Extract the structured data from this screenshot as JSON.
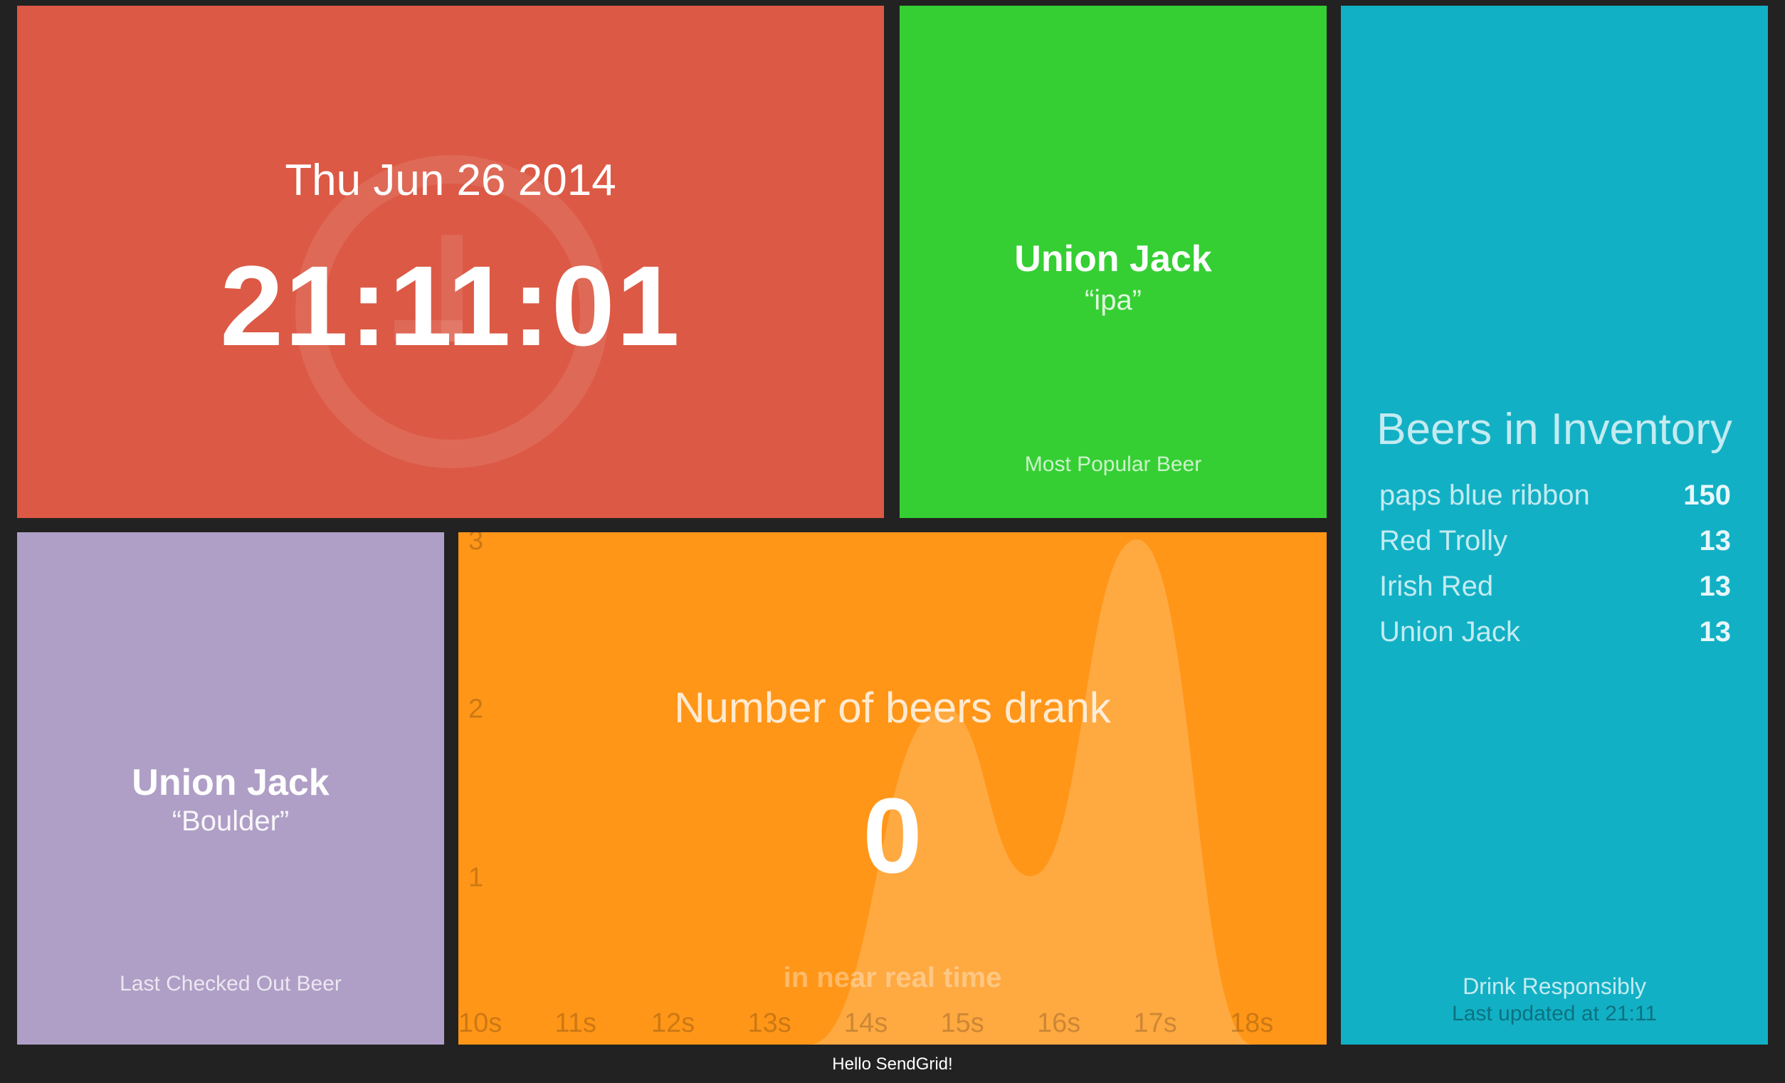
{
  "clock": {
    "date": "Thu Jun 26 2014",
    "time": "21:11:01",
    "color": "#dc5945"
  },
  "popular": {
    "name": "Union Jack",
    "style": "“ipa”",
    "caption": "Most Popular Beer",
    "color": "#35cf33"
  },
  "inventory": {
    "title": "Beers in Inventory",
    "items": [
      {
        "label": "paps blue ribbon",
        "value": "150"
      },
      {
        "label": "Red Trolly",
        "value": "13"
      },
      {
        "label": "Irish Red",
        "value": "13"
      },
      {
        "label": "Union Jack",
        "value": "13"
      }
    ],
    "more_info": "Drink Responsibly",
    "updated": "Last updated at 21:11",
    "color": "#12b0c5"
  },
  "last_out": {
    "name": "Union Jack",
    "style": "“Boulder”",
    "caption": "Last Checked Out Beer",
    "color": "#af9fc6"
  },
  "graph": {
    "title": "Number of beers drank",
    "current": "0",
    "more_info": "in near real time",
    "color": "#ff9618"
  },
  "chart_data": {
    "type": "area",
    "x": [
      "10s",
      "11s",
      "12s",
      "13s",
      "14s",
      "15s",
      "16s",
      "17s",
      "18s"
    ],
    "x_numeric": [
      10,
      11,
      12,
      13,
      14,
      15,
      16,
      17,
      18
    ],
    "points": [
      {
        "x": 13.4,
        "y": 0
      },
      {
        "x": 14.8,
        "y": 2
      },
      {
        "x": 15.7,
        "y": 1
      },
      {
        "x": 16.8,
        "y": 3
      },
      {
        "x": 18.0,
        "y": 0
      }
    ],
    "y_ticks": [
      "1",
      "2",
      "3"
    ],
    "ylim": [
      0,
      3
    ],
    "xlim": [
      10,
      19
    ]
  },
  "footer": {
    "text": "Hello SendGrid!"
  }
}
